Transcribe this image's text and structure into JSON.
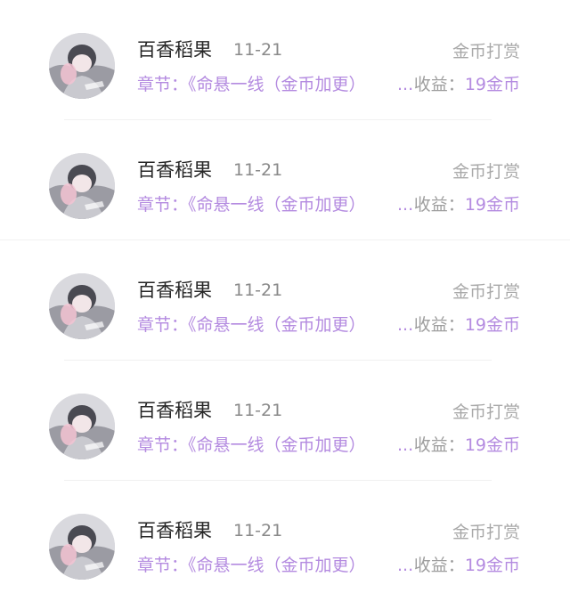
{
  "colors": {
    "accent_purple": "#b48be0",
    "name_text": "#262626",
    "muted_text": "#8a8a8a",
    "reward_type_text": "#a9a9a9"
  },
  "records": [
    {
      "name": "百香稻果",
      "date": "11-21",
      "reward_type": "金币打赏",
      "chapter": "章节：《命悬一线（金币加更）",
      "ellipsis": "...",
      "income_label": "收益：",
      "income_value": "19金币",
      "avatar_icon": "user-avatar"
    },
    {
      "name": "百香稻果",
      "date": "11-21",
      "reward_type": "金币打赏",
      "chapter": "章节：《命悬一线（金币加更）",
      "ellipsis": "...",
      "income_label": "收益：",
      "income_value": "19金币",
      "avatar_icon": "user-avatar"
    },
    {
      "name": "百香稻果",
      "date": "11-21",
      "reward_type": "金币打赏",
      "chapter": "章节：《命悬一线（金币加更）",
      "ellipsis": "...",
      "income_label": "收益：",
      "income_value": "19金币",
      "avatar_icon": "user-avatar"
    },
    {
      "name": "百香稻果",
      "date": "11-21",
      "reward_type": "金币打赏",
      "chapter": "章节：《命悬一线（金币加更）",
      "ellipsis": "...",
      "income_label": "收益：",
      "income_value": "19金币",
      "avatar_icon": "user-avatar"
    },
    {
      "name": "百香稻果",
      "date": "11-21",
      "reward_type": "金币打赏",
      "chapter": "章节：《命悬一线（金币加更）",
      "ellipsis": "...",
      "income_label": "收益：",
      "income_value": "19金币",
      "avatar_icon": "user-avatar"
    }
  ]
}
